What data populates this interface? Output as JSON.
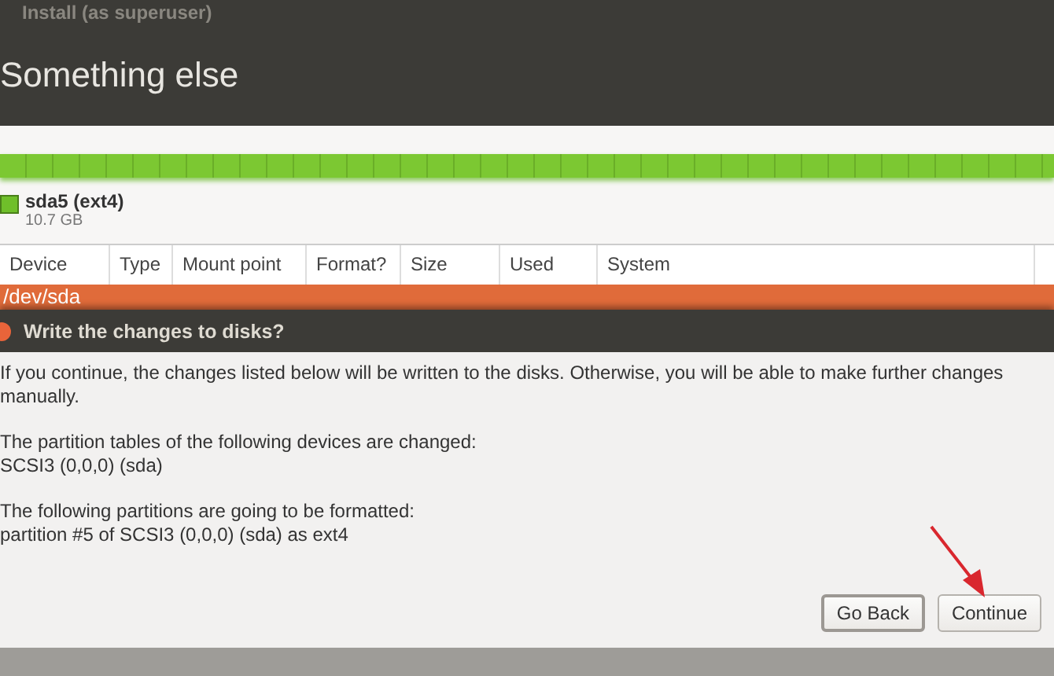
{
  "window": {
    "title": "Install (as superuser)"
  },
  "header": {
    "title": "Something else"
  },
  "partition_bar": {
    "level": 1
  },
  "legend": {
    "name": "sda5 (ext4)",
    "size": "10.7 GB",
    "color": "#6fbf2a"
  },
  "table": {
    "columns": [
      "Device",
      "Type",
      "Mount point",
      "Format?",
      "Size",
      "Used",
      "System"
    ],
    "rows": [
      {
        "device": "/dev/sda",
        "selected": true
      }
    ]
  },
  "dialog": {
    "title": "Write the changes to disks?",
    "paragraphs": [
      "If you continue, the changes listed below will be written to the disks. Otherwise, you will be able to make further changes manually.",
      "The partition tables of the following devices are changed:\n SCSI3 (0,0,0) (sda)",
      "The following partitions are going to be formatted:\n partition #5 of SCSI3 (0,0,0) (sda) as ext4"
    ],
    "buttons": [
      {
        "label": "Go Back",
        "kind": "default"
      },
      {
        "label": "Continue",
        "kind": "plain"
      }
    ]
  }
}
